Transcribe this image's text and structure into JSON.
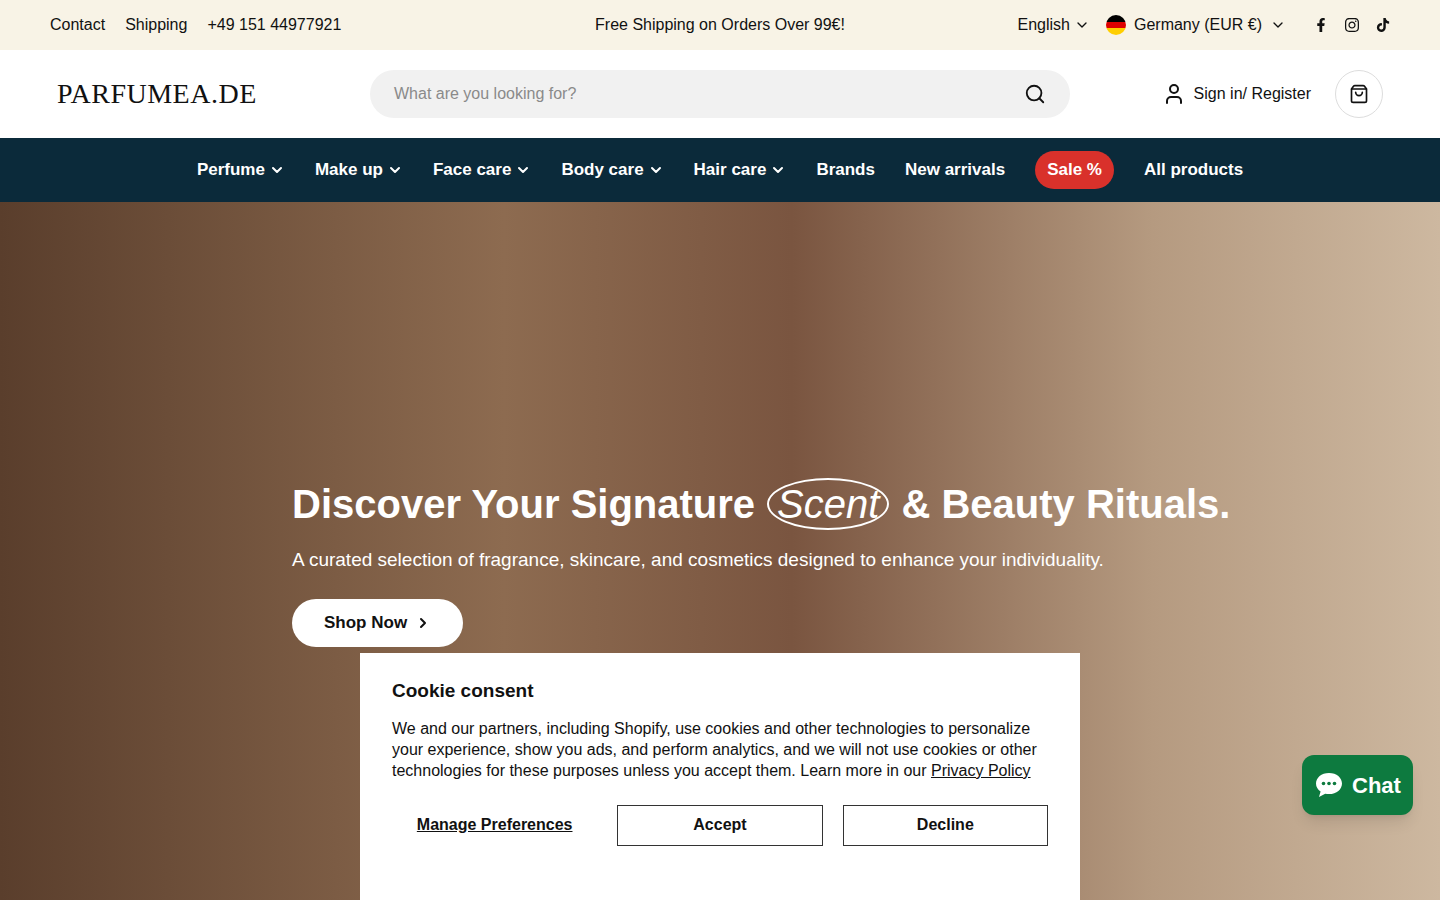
{
  "top_bar": {
    "links": [
      "Contact",
      "Shipping",
      "+49 151 44977921"
    ],
    "announcement": "Free Shipping on Orders Over 99€!",
    "language": "English",
    "country": "Germany (EUR €)"
  },
  "header": {
    "logo": "PARFUMEA.DE",
    "search_placeholder": "What are you looking for?",
    "account": "Sign in/ Register"
  },
  "nav": {
    "items": [
      {
        "label": "Perfume",
        "has_dropdown": true,
        "highlighted": false
      },
      {
        "label": "Make up",
        "has_dropdown": true,
        "highlighted": false
      },
      {
        "label": "Face care",
        "has_dropdown": true,
        "highlighted": false
      },
      {
        "label": "Body care",
        "has_dropdown": true,
        "highlighted": false
      },
      {
        "label": "Hair care",
        "has_dropdown": true,
        "highlighted": false
      },
      {
        "label": "Brands",
        "has_dropdown": false,
        "highlighted": false
      },
      {
        "label": "New arrivals",
        "has_dropdown": false,
        "highlighted": false
      },
      {
        "label": "Sale %",
        "has_dropdown": false,
        "highlighted": true
      },
      {
        "label": "All products",
        "has_dropdown": false,
        "highlighted": false
      }
    ]
  },
  "hero": {
    "title_before": "Discover Your Signature",
    "title_emphasis": "Scent",
    "title_after": "& Beauty Rituals.",
    "subtitle": "A curated selection of fragrance, skincare, and cosmetics designed to enhance your individuality.",
    "button": "Shop Now"
  },
  "cookie": {
    "title": "Cookie consent",
    "text": "We and our partners, including Shopify, use cookies and other technologies to personalize your experience, show you ads, and perform analytics, and we will not use cookies or other technologies for these purposes unless you accept them. Learn more in our",
    "link": "Privacy Policy",
    "buttons": [
      "Manage Preferences",
      "Accept",
      "Decline"
    ]
  },
  "chat": {
    "label": "Chat"
  }
}
